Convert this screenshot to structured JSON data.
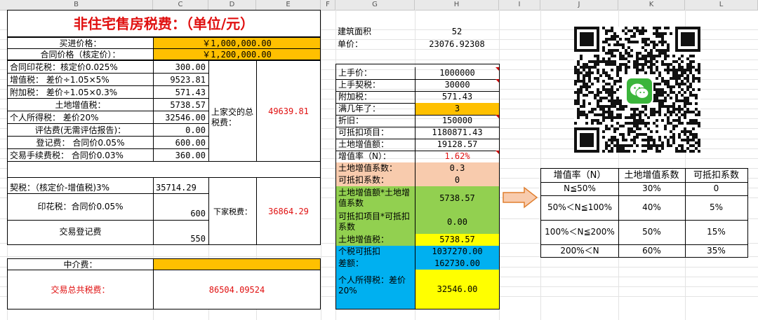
{
  "column_headers": [
    "B",
    "C",
    "D",
    "E",
    "F",
    "G",
    "H",
    "I",
    "J",
    "K",
    "L"
  ],
  "left": {
    "title": "非住宅售房税费：（单位/元）",
    "purchase_price_label": "买进价格：",
    "purchase_price_value": "￥1,000,000.00",
    "contract_price_label": "合同价格（核定价）：",
    "contract_price_value": "￥1,200,000.00",
    "seller_rows": [
      {
        "label": "合同印花税：核定价0.025%",
        "value": "300.00"
      },
      {
        "label": "增值税： 差价÷1.05×5%",
        "value": "9523.81"
      },
      {
        "label": "附加税： 差价÷1.05×0.3%",
        "value": "571.43"
      },
      {
        "label": "土地增值税：",
        "value": "5738.57"
      },
      {
        "label": "个人所得税： 差价20%",
        "value": "32546.00"
      },
      {
        "label": "评估费(无需评估报告)：",
        "value": "0.00"
      },
      {
        "label": "登记费： 合同价0.05%",
        "value": "600.00"
      },
      {
        "label": "交易手续费税： 合同价0.03%",
        "value": "360.00"
      }
    ],
    "upper_total_label": "上家交的总税费：",
    "upper_total_value": "49639.81",
    "deed_tax_label": "契税：（核定价-增值税)3%",
    "deed_tax_value": "35714.29",
    "stamp_tax_label": "印花税：合同价0.05%",
    "stamp_tax_value": "600",
    "registration_label": "交易登记费",
    "registration_value": "550",
    "lower_total_label": "下家税费：",
    "lower_total_value": "36864.29",
    "agency_fee_label": "中介费：",
    "agency_fee_value": "",
    "grand_total_label": "交易总共税费：",
    "grand_total_value": "86504.09524"
  },
  "middle": {
    "area_label": "建筑面积",
    "area_value": "52",
    "unit_price_label": "单价：",
    "unit_price_value": "23076.92308",
    "rows": [
      {
        "label": "上手价：",
        "value": "1000000"
      },
      {
        "label": "上手契税：",
        "value": "30000"
      },
      {
        "label": "附加税：",
        "value": "571.43"
      },
      {
        "label": "满几年了：",
        "value": "3"
      },
      {
        "label": "折旧：",
        "value": "150000"
      },
      {
        "label": "可抵扣项目：",
        "value": "1180871.43"
      },
      {
        "label": "土地增值额：",
        "value": "19128.57"
      },
      {
        "label": "增值率（N）：",
        "value": "1.62%"
      },
      {
        "label": "土地增值系数：",
        "value": "0.3"
      },
      {
        "label": "可抵扣系数：",
        "value": "0"
      },
      {
        "label": "土地增值额*土地增值系数",
        "value": "5738.57"
      },
      {
        "label": "可抵扣项目*可抵扣系数",
        "value": "0.00"
      },
      {
        "label": "土地增值税：",
        "value": "5738.57"
      },
      {
        "label": "个税可抵扣",
        "value": "1037270.00"
      },
      {
        "label": "差额：",
        "value": "162730.00"
      },
      {
        "label": "个人所得税：差价20%",
        "value": "32546.00"
      }
    ]
  },
  "rate_table": {
    "headers": [
      "增值率（N）",
      "土地增值系数",
      "可抵扣系数"
    ],
    "rows": [
      [
        "N≦50%",
        "30%",
        "0"
      ],
      [
        "50%＜N≦100%",
        "40%",
        "5%"
      ],
      [
        "100%＜N≦200%",
        "50%",
        "15%"
      ],
      [
        "200%＜N",
        "60%",
        "35%"
      ]
    ]
  },
  "colors": {
    "orange": "#ffc000",
    "peach": "#f8cbad",
    "green": "#92d050",
    "yellow": "#ffff00",
    "blue": "#00b0f0",
    "red_text": "#e01010",
    "arrow_fill": "#f8cbad",
    "arrow_stroke": "#e07f2f"
  },
  "icons": [
    "qr-code-icon",
    "wechat-icon",
    "right-arrow-icon"
  ]
}
